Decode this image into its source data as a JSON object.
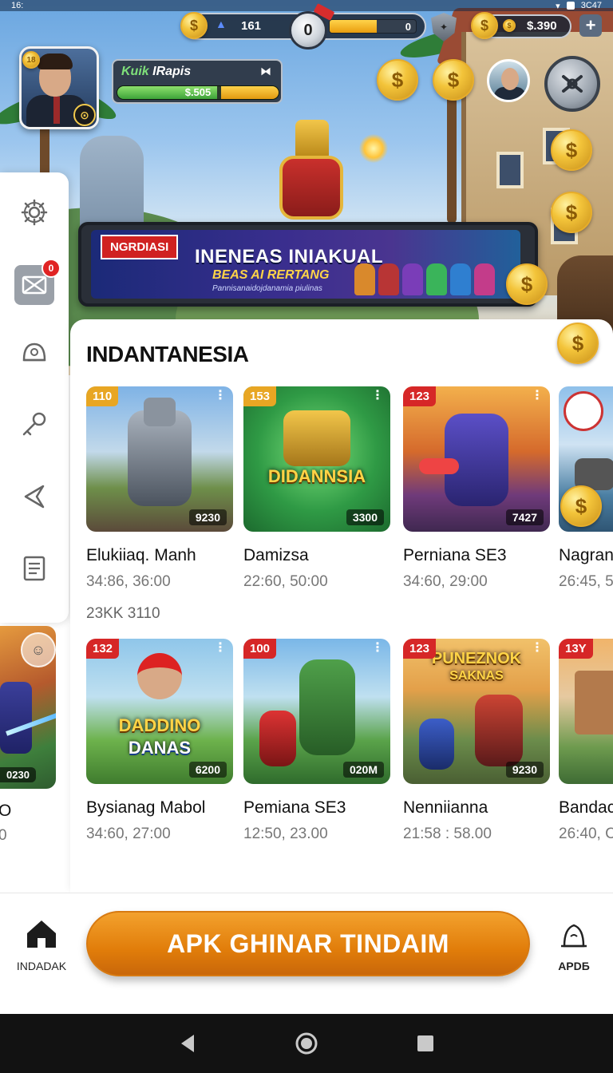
{
  "status_bar": {
    "time": "16:",
    "right_text": "3C47"
  },
  "hud": {
    "left_value": "161",
    "level_circle": "0",
    "progress_cap": "0",
    "progress_fraction": 0.55,
    "right_value": "$.390",
    "plus_label": "+"
  },
  "profile": {
    "level": "18",
    "name_accent": "Kuik",
    "name_rest": " IRapis",
    "xp_label": "$.505",
    "xp_fraction": 0.62,
    "badge_icon": "camera-badge-icon"
  },
  "banner": {
    "tag": "NGRDIASI",
    "headline": "INENEAS INIAKUAL",
    "subline": "BEAS AI RERTANG",
    "fine_print": "Pannisanaidojdanamia piulinas"
  },
  "sidebar": {
    "items": [
      {
        "icon": "gear-icon"
      },
      {
        "icon": "mail-icon",
        "badge": "0"
      },
      {
        "icon": "helmet-icon"
      },
      {
        "icon": "key-icon"
      },
      {
        "icon": "share-icon"
      },
      {
        "icon": "document-icon"
      }
    ],
    "thumb_value": "0230",
    "caption_1": "O",
    "caption_2": "0"
  },
  "section": {
    "title": "INDANTANESIA",
    "row1": [
      {
        "badge": "110",
        "badge_color": "#e8a623",
        "value": "9230",
        "title": "Elukiiaq. Manh",
        "meta": "34:86, 36:00",
        "meta2": "23KK 3110"
      },
      {
        "badge": "153",
        "badge_color": "#e8a623",
        "value": "3300",
        "logo": "DIDANNSIA",
        "title": "Damizsa",
        "meta": "22:60, 50:00"
      },
      {
        "badge": "123",
        "badge_color": "#d62727",
        "value": "7427",
        "title": "Perniana SE3",
        "meta": "34:60, 29:00"
      },
      {
        "title": "Nagran",
        "meta": "26:45, 5"
      }
    ],
    "row2": [
      {
        "badge": "132",
        "badge_color": "#d62727",
        "value": "6200",
        "logo": "DADDINO",
        "logo2": "DANAS",
        "title": "Bysianag Mabol",
        "meta": "34:60, 27:00"
      },
      {
        "badge": "100",
        "badge_color": "#d62727",
        "value": "020M",
        "title": "Pemiana SE3",
        "meta": "12:50, 23.00"
      },
      {
        "badge": "123",
        "badge_color": "#d62727",
        "value": "9230",
        "logo": "PUNEZNOK",
        "logo2": "SAKNAS",
        "title": "Nenniianna",
        "meta": "21:58 : 58.00"
      },
      {
        "badge": "13Y",
        "badge_color": "#d62727",
        "title": "Bandac",
        "meta": "26:40, C"
      }
    ]
  },
  "bottom": {
    "home_label": "INDADAK",
    "cta_label": "APK GHINAR TINDAIM",
    "apps_label": "APDБ"
  },
  "colors": {
    "accent": "#e17d0a",
    "badge_red": "#d62727",
    "badge_gold": "#e8a623"
  }
}
